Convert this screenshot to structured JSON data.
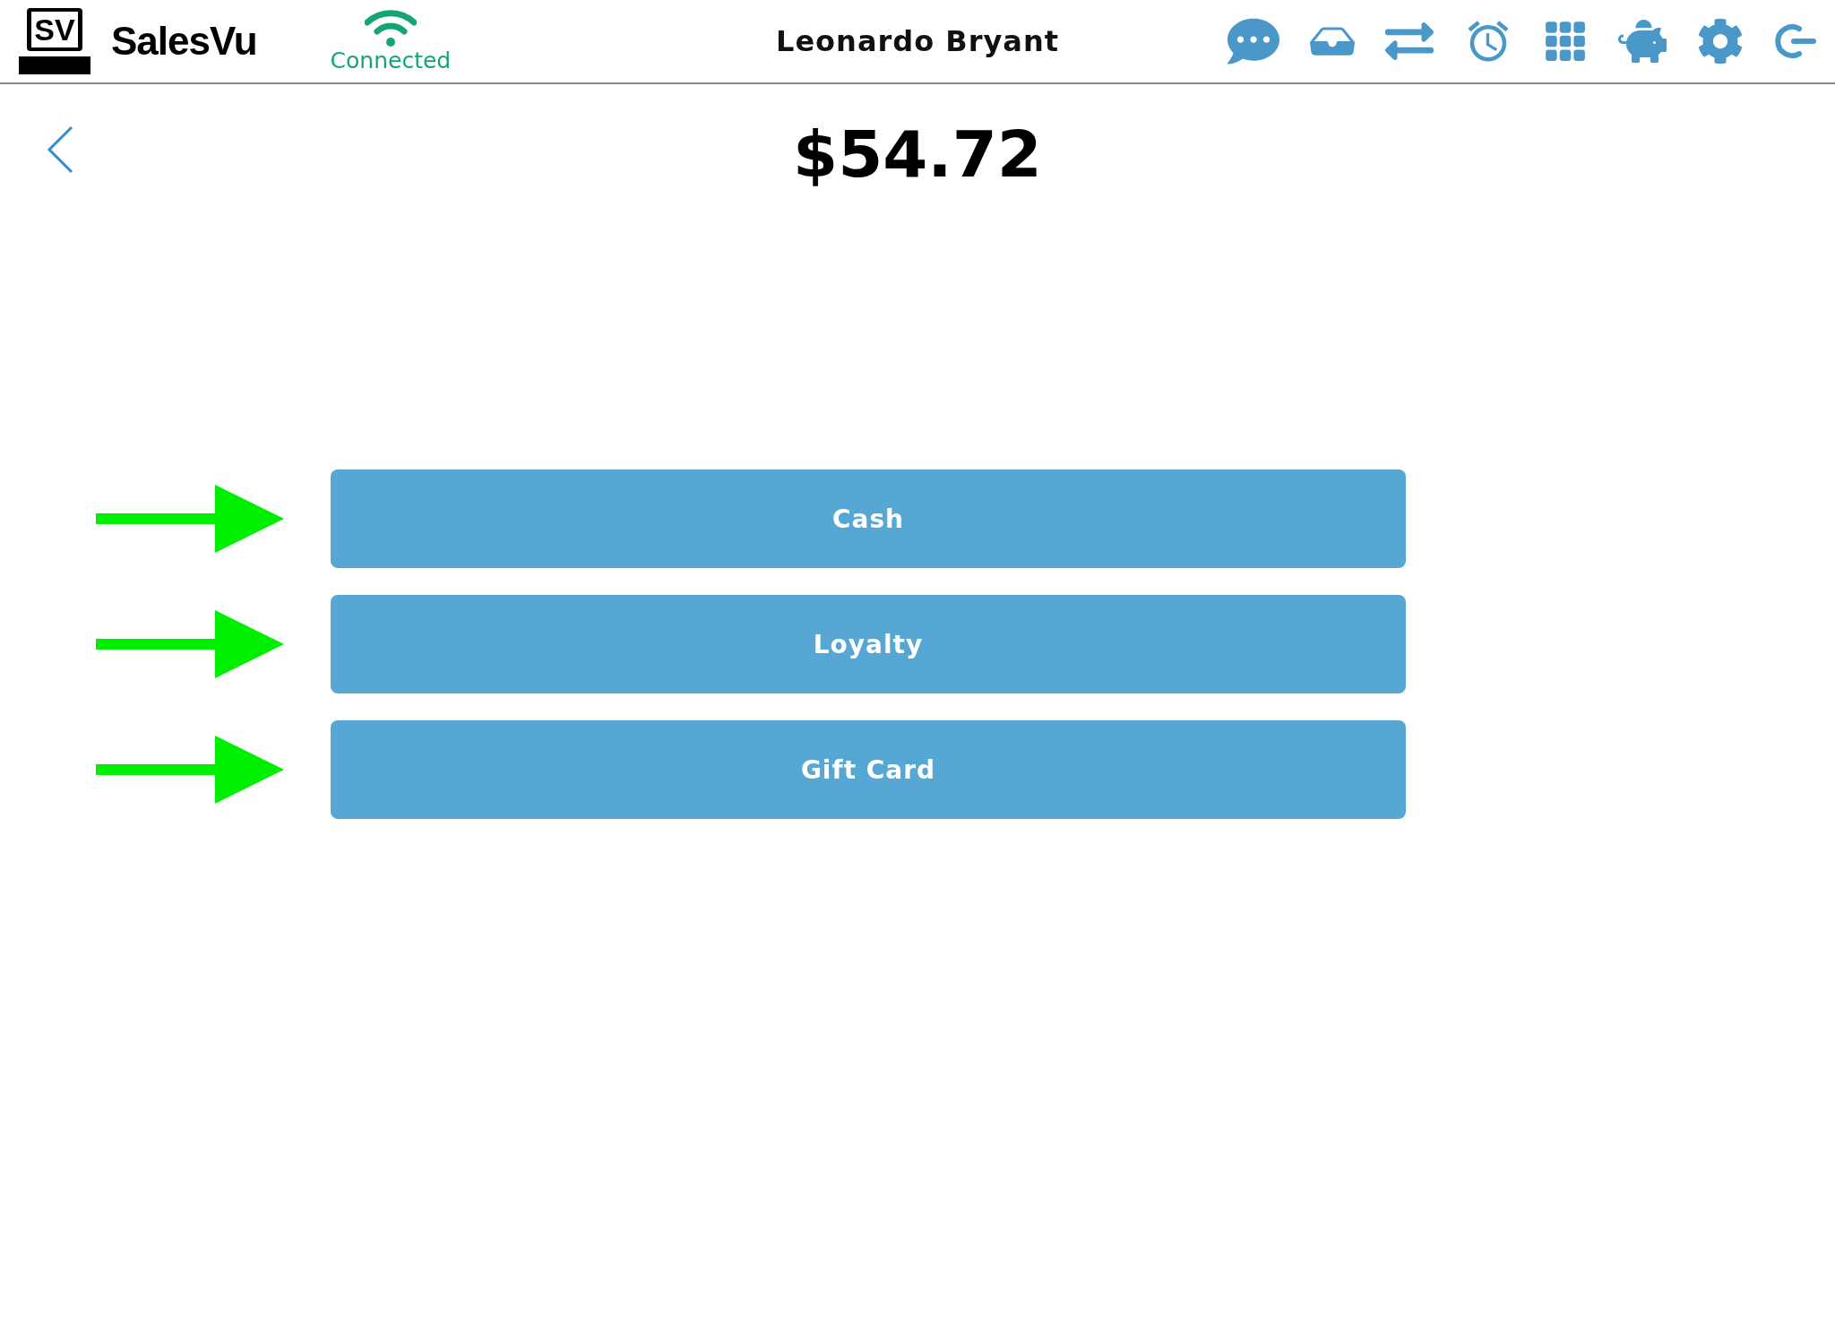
{
  "header": {
    "logo_mark": "SV",
    "brand": "SalesVu",
    "connection": "Connected",
    "user": "Leonardo Bryant"
  },
  "amount": "$54.72",
  "payment_options": [
    {
      "label": "Cash"
    },
    {
      "label": "Loyalty"
    },
    {
      "label": "Gift Card"
    }
  ]
}
